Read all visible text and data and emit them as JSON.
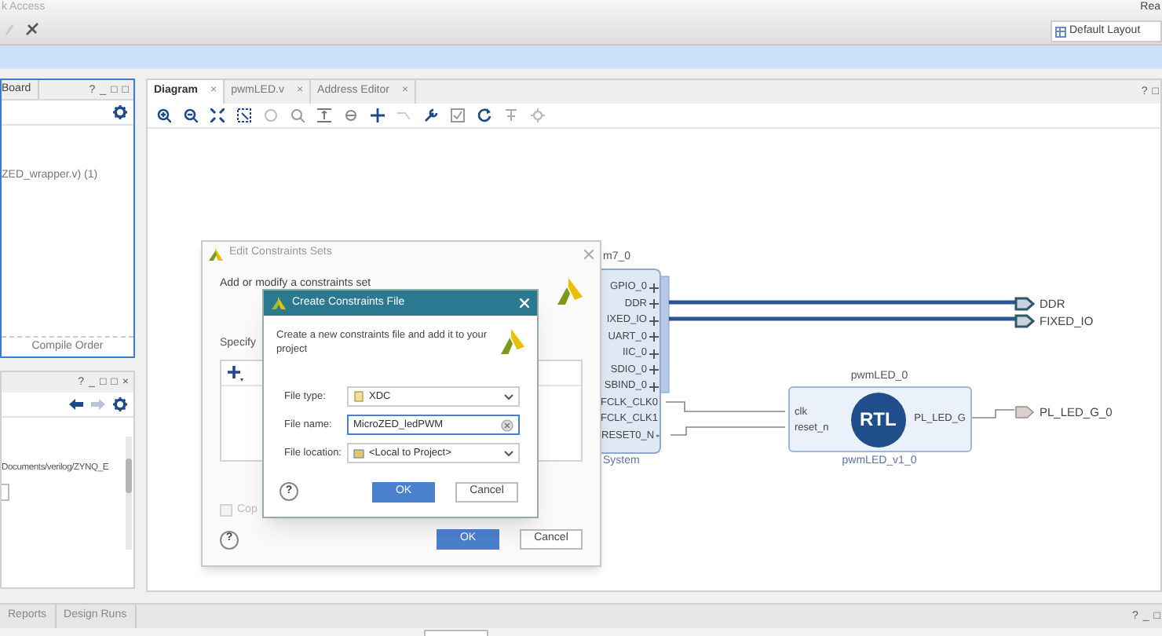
{
  "top_bar": {
    "menu_fragment": "k Access",
    "status_fragment": "Rea",
    "layout_selector": {
      "value": "Default Layout"
    }
  },
  "sources_panel": {
    "tab": "Board",
    "controls": [
      "?",
      "_",
      "□",
      "□"
    ],
    "tree_item": "ZED_wrapper.v) (1)",
    "bottom_tab": "Compile Order"
  },
  "properties_panel": {
    "controls": [
      "?",
      "_",
      "□",
      "□",
      "×"
    ],
    "path": "Documents/verilog/ZYNQ_E"
  },
  "editor_tabs": [
    {
      "label": "Diagram",
      "close": "×",
      "selected": true
    },
    {
      "label": "pwmLED.v",
      "close": "×",
      "selected": false
    },
    {
      "label": "Address Editor",
      "close": "×",
      "selected": false
    }
  ],
  "editor_controls": [
    "?",
    "□"
  ],
  "diagram": {
    "zynq_block": {
      "name": "m7_0",
      "footer": "System",
      "ports": [
        {
          "label": "GPIO_0",
          "kind": "bus"
        },
        {
          "label": "DDR",
          "kind": "bus"
        },
        {
          "label": "IXED_IO",
          "kind": "bus"
        },
        {
          "label": "UART_0",
          "kind": "bus"
        },
        {
          "label": "IIC_0",
          "kind": "bus"
        },
        {
          "label": "SDIO_0",
          "kind": "bus"
        },
        {
          "label": "SBIND_0",
          "kind": "bus"
        },
        {
          "label": "FCLK_CLK0",
          "kind": "clock"
        },
        {
          "label": "FCLK_CLK1",
          "kind": "clock"
        },
        {
          "label": "RESET0_N",
          "kind": "reset"
        }
      ]
    },
    "ip_block": {
      "name": "pwmLED_0",
      "logo": "RTL",
      "inputs": [
        "clk",
        "reset_n"
      ],
      "output": "PL_LED_G",
      "type": "pwmLED_v1_0"
    },
    "external_ports": [
      {
        "label": "DDR",
        "kind": "bus"
      },
      {
        "label": "FIXED_IO",
        "kind": "bus"
      },
      {
        "label": "PL_LED_G_0",
        "kind": "signal"
      }
    ]
  },
  "edit_constraints_dialog": {
    "title": "Edit Constraints Sets",
    "intro": "Add or modify a constraints set",
    "section": "Specify",
    "help": "?",
    "copy_option": {
      "label": "Cop",
      "checked": false,
      "disabled": true
    },
    "ok": "OK",
    "cancel": "Cancel"
  },
  "create_constraints_dialog": {
    "title": "Create Constraints File",
    "description": "Create a new constraints file and add it to your project",
    "fields": [
      {
        "label": "File type:",
        "kind": "select",
        "value": "XDC",
        "focused": false
      },
      {
        "label": "File name:",
        "kind": "text",
        "value": "MicroZED_ledPWM",
        "focused": true
      },
      {
        "label": "File location:",
        "kind": "select",
        "value": "<Local to Project>",
        "focused": false
      }
    ],
    "help": "?",
    "ok": "OK",
    "cancel": "Cancel"
  },
  "bottom_tabs": [
    {
      "label": "Reports"
    },
    {
      "label": "Design Runs"
    }
  ],
  "bottom_controls": [
    "?",
    "_",
    "□"
  ]
}
